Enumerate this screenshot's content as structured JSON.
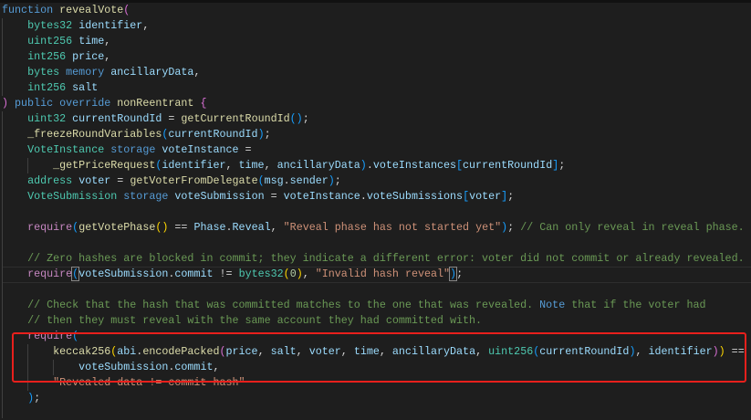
{
  "editor": {
    "language": "solidity",
    "lines": [
      [
        [
          "k",
          "function"
        ],
        [
          "p",
          " "
        ],
        [
          "f",
          "revealVote"
        ],
        [
          "b1",
          "("
        ]
      ],
      [
        [
          "p",
          "    "
        ],
        [
          "t",
          "bytes32"
        ],
        [
          "p",
          " "
        ],
        [
          "v",
          "identifier"
        ],
        [
          "p",
          ","
        ]
      ],
      [
        [
          "p",
          "    "
        ],
        [
          "t",
          "uint256"
        ],
        [
          "p",
          " "
        ],
        [
          "v",
          "time"
        ],
        [
          "p",
          ","
        ]
      ],
      [
        [
          "p",
          "    "
        ],
        [
          "t",
          "int256"
        ],
        [
          "p",
          " "
        ],
        [
          "v",
          "price"
        ],
        [
          "p",
          ","
        ]
      ],
      [
        [
          "p",
          "    "
        ],
        [
          "t",
          "bytes"
        ],
        [
          "p",
          " "
        ],
        [
          "k",
          "memory"
        ],
        [
          "p",
          " "
        ],
        [
          "v",
          "ancillaryData"
        ],
        [
          "p",
          ","
        ]
      ],
      [
        [
          "p",
          "    "
        ],
        [
          "t",
          "int256"
        ],
        [
          "p",
          " "
        ],
        [
          "v",
          "salt"
        ]
      ],
      [
        [
          "b1",
          ")"
        ],
        [
          "p",
          " "
        ],
        [
          "k",
          "public"
        ],
        [
          "p",
          " "
        ],
        [
          "k",
          "override"
        ],
        [
          "p",
          " "
        ],
        [
          "f",
          "nonReentrant"
        ],
        [
          "p",
          " "
        ],
        [
          "b1",
          "{"
        ]
      ],
      [
        [
          "p",
          "    "
        ],
        [
          "t",
          "uint32"
        ],
        [
          "p",
          " "
        ],
        [
          "v",
          "currentRoundId"
        ],
        [
          "p",
          " = "
        ],
        [
          "f",
          "getCurrentRoundId"
        ],
        [
          "b2",
          "()"
        ],
        [
          "p",
          ";"
        ]
      ],
      [
        [
          "p",
          "    "
        ],
        [
          "f",
          "_freezeRoundVariables"
        ],
        [
          "b2",
          "("
        ],
        [
          "v",
          "currentRoundId"
        ],
        [
          "b2",
          ")"
        ],
        [
          "p",
          ";"
        ]
      ],
      [
        [
          "p",
          "    "
        ],
        [
          "t",
          "VoteInstance"
        ],
        [
          "p",
          " "
        ],
        [
          "k",
          "storage"
        ],
        [
          "p",
          " "
        ],
        [
          "v",
          "voteInstance"
        ],
        [
          "p",
          " ="
        ]
      ],
      [
        [
          "p",
          "        "
        ],
        [
          "f",
          "_getPriceRequest"
        ],
        [
          "b2",
          "("
        ],
        [
          "v",
          "identifier"
        ],
        [
          "p",
          ", "
        ],
        [
          "v",
          "time"
        ],
        [
          "p",
          ", "
        ],
        [
          "v",
          "ancillaryData"
        ],
        [
          "b2",
          ")"
        ],
        [
          "p",
          "."
        ],
        [
          "v",
          "voteInstances"
        ],
        [
          "b2",
          "["
        ],
        [
          "v",
          "currentRoundId"
        ],
        [
          "b2",
          "]"
        ],
        [
          "p",
          ";"
        ]
      ],
      [
        [
          "p",
          "    "
        ],
        [
          "t",
          "address"
        ],
        [
          "p",
          " "
        ],
        [
          "v",
          "voter"
        ],
        [
          "p",
          " = "
        ],
        [
          "f",
          "getVoterFromDelegate"
        ],
        [
          "b2",
          "("
        ],
        [
          "v",
          "msg"
        ],
        [
          "p",
          "."
        ],
        [
          "v",
          "sender"
        ],
        [
          "b2",
          ")"
        ],
        [
          "p",
          ";"
        ]
      ],
      [
        [
          "p",
          "    "
        ],
        [
          "t",
          "VoteSubmission"
        ],
        [
          "p",
          " "
        ],
        [
          "k",
          "storage"
        ],
        [
          "p",
          " "
        ],
        [
          "v",
          "voteSubmission"
        ],
        [
          "p",
          " = "
        ],
        [
          "v",
          "voteInstance"
        ],
        [
          "p",
          "."
        ],
        [
          "v",
          "voteSubmissions"
        ],
        [
          "b2",
          "["
        ],
        [
          "v",
          "voter"
        ],
        [
          "b2",
          "]"
        ],
        [
          "p",
          ";"
        ]
      ],
      [],
      [
        [
          "p",
          "    "
        ],
        [
          "r",
          "require"
        ],
        [
          "b2",
          "("
        ],
        [
          "f",
          "getVotePhase"
        ],
        [
          "b3",
          "()"
        ],
        [
          "p",
          " == "
        ],
        [
          "v",
          "Phase"
        ],
        [
          "p",
          "."
        ],
        [
          "v",
          "Reveal"
        ],
        [
          "p",
          ", "
        ],
        [
          "s",
          "\"Reveal phase has not started yet\""
        ],
        [
          "b2",
          ")"
        ],
        [
          "p",
          "; "
        ],
        [
          "c",
          "// Can only reveal in reveal phase."
        ]
      ],
      [],
      [
        [
          "p",
          "    "
        ],
        [
          "c",
          "// Zero hashes are blocked in commit; they indicate a different error: voter did not commit or already revealed."
        ]
      ],
      [
        [
          "p",
          "    "
        ],
        [
          "r",
          "require"
        ],
        [
          "b2 match",
          "("
        ],
        [
          "v",
          "voteSubmission"
        ],
        [
          "p",
          "."
        ],
        [
          "v",
          "commit"
        ],
        [
          "p",
          " != "
        ],
        [
          "t",
          "bytes32"
        ],
        [
          "b3",
          "("
        ],
        [
          "n",
          "0"
        ],
        [
          "b3",
          ")"
        ],
        [
          "p",
          ", "
        ],
        [
          "s",
          "\"Invalid hash reveal\""
        ],
        [
          "b2 match",
          ")"
        ],
        [
          "p",
          ";"
        ]
      ],
      [],
      [
        [
          "p",
          "    "
        ],
        [
          "c",
          "// Check that the hash that was committed matches to the one that was revealed. "
        ],
        [
          "note",
          "Note"
        ],
        [
          "c",
          " that if the voter had"
        ]
      ],
      [
        [
          "p",
          "    "
        ],
        [
          "c",
          "// then they must reveal with the same account they had committed with."
        ]
      ],
      [
        [
          "p",
          "    "
        ],
        [
          "r",
          "require"
        ],
        [
          "b2",
          "("
        ]
      ],
      [
        [
          "p",
          "        "
        ],
        [
          "f",
          "keccak256"
        ],
        [
          "b3",
          "("
        ],
        [
          "v",
          "abi"
        ],
        [
          "p",
          "."
        ],
        [
          "f",
          "encodePacked"
        ],
        [
          "b1",
          "("
        ],
        [
          "v",
          "price"
        ],
        [
          "p",
          ", "
        ],
        [
          "v",
          "salt"
        ],
        [
          "p",
          ", "
        ],
        [
          "v",
          "voter"
        ],
        [
          "p",
          ", "
        ],
        [
          "v",
          "time"
        ],
        [
          "p",
          ", "
        ],
        [
          "v",
          "ancillaryData"
        ],
        [
          "p",
          ", "
        ],
        [
          "t",
          "uint256"
        ],
        [
          "b2",
          "("
        ],
        [
          "v",
          "currentRoundId"
        ],
        [
          "b2",
          ")"
        ],
        [
          "p",
          ", "
        ],
        [
          "v",
          "identifier"
        ],
        [
          "b1",
          ")"
        ],
        [
          "b3",
          ")"
        ],
        [
          "p",
          " =="
        ]
      ],
      [
        [
          "p",
          "            "
        ],
        [
          "v",
          "voteSubmission"
        ],
        [
          "p",
          "."
        ],
        [
          "v",
          "commit"
        ],
        [
          "p",
          ","
        ]
      ],
      [
        [
          "p",
          "        "
        ],
        [
          "s",
          "\"Revealed data != commit hash\""
        ]
      ],
      [
        [
          "p",
          "    "
        ],
        [
          "b2",
          ")"
        ],
        [
          "p",
          ";"
        ]
      ]
    ],
    "current_line_index": 17,
    "highlight_color": "#e8201c",
    "background": "#1e1e1e"
  }
}
